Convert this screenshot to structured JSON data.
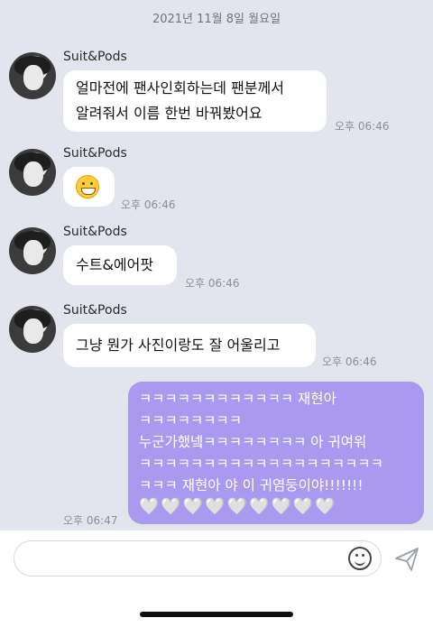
{
  "date_separator": "2021년 11월 8일 월요일",
  "messages": [
    {
      "sender": "Suit&Pods",
      "line1": "얼마전에 팬사인회하는데 팬분께서",
      "line2": "알려줘서 이름 한번 바꿔봤어요",
      "time": "오후 06:46"
    },
    {
      "sender": "Suit&Pods",
      "emoji": "grinning-face",
      "time": "오후 06:46"
    },
    {
      "sender": "Suit&Pods",
      "text": "수트&에어팟",
      "time": "오후 06:46"
    },
    {
      "sender": "Suit&Pods",
      "text": "그냥 뭔가 사진이랑도 잘 어울리고",
      "time": "오후 06:46"
    }
  ],
  "my_message": {
    "lines": [
      "ㅋㅋㅋㅋㅋㅋㅋㅋㅋㅋㅋㅋ 재현아",
      "ㅋㅋㅋㅋㅋㅋㅋㅋ",
      "누군가했넼ㅋㅋㅋㅋㅋㅋㅋㅋ 아 귀여워",
      "ㅋㅋㅋㅋㅋㅋㅋㅋㅋㅋㅋㅋㅋㅋㅋㅋㅋㅋㅋ",
      "ㅋㅋㅋ 재현아 야 이 귀염둥이야!!!!!!!",
      "🤍🤍🤍🤍🤍🤍🤍🤍🤍"
    ],
    "time": "오후 06:47",
    "color": "#a99af0"
  },
  "composer": {
    "placeholder": "",
    "emoji_icon": "smile-icon",
    "send_icon": "send-icon"
  }
}
